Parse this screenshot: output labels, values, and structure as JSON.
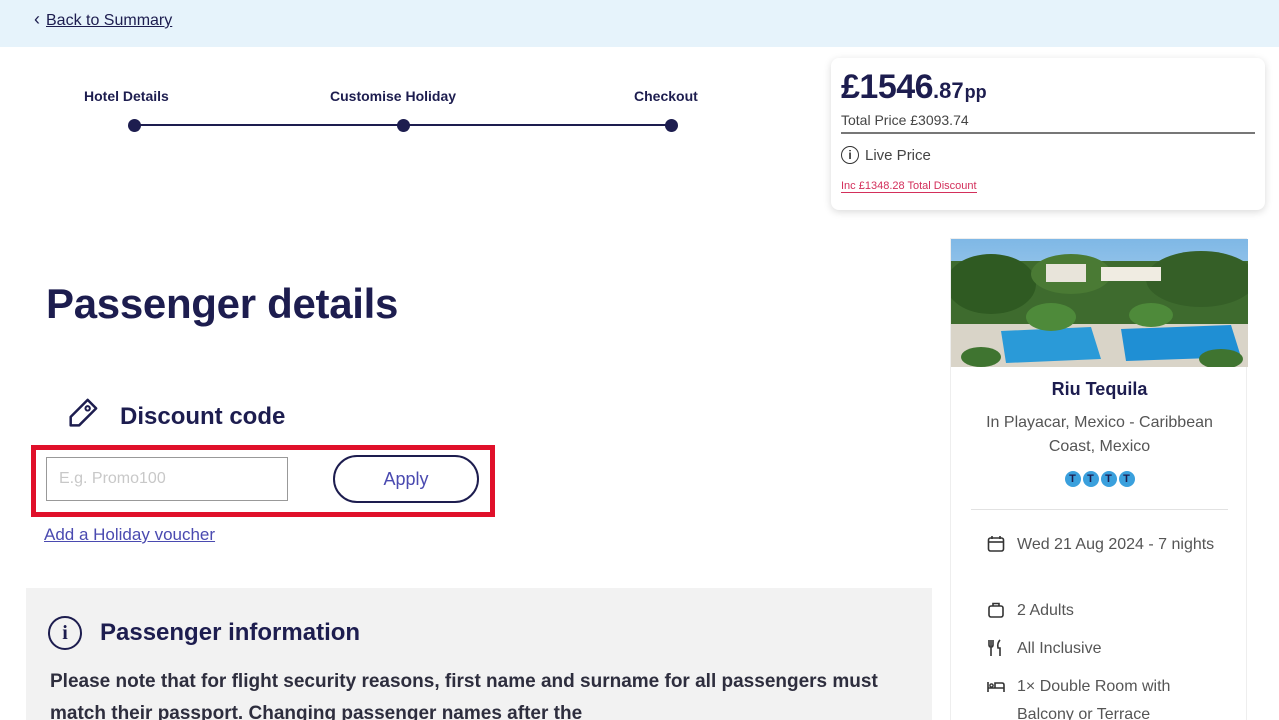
{
  "nav": {
    "back_label": "Back to Summary"
  },
  "steps": [
    {
      "label": "Hotel Details"
    },
    {
      "label": "Customise Holiday"
    },
    {
      "label": "Checkout"
    }
  ],
  "price": {
    "whole": "£1546",
    "decimal": ".87",
    "per": "pp",
    "total": "Total Price £3093.74",
    "live": "Live Price",
    "discount": "Inc £1348.28 Total Discount"
  },
  "page_title": "Passenger details",
  "discount": {
    "heading": "Discount code",
    "placeholder": "E.g. Promo100",
    "apply_label": "Apply",
    "voucher_link": "Add a Holiday voucher"
  },
  "passenger_info": {
    "heading": "Passenger information",
    "text": "Please note that for flight security reasons, first name and surname for all passengers must match their passport. Changing passenger names after the"
  },
  "hotel": {
    "name": "Riu Tequila",
    "location": "In Playacar, Mexico - Caribbean Coast, Mexico",
    "rating_glyph": "T",
    "rating_count": 4,
    "details": {
      "date": "Wed 21 Aug 2024 - 7 nights",
      "guests": "2 Adults",
      "board": "All Inclusive",
      "room": "1× Double Room with Balcony or Terrace"
    }
  },
  "colors": {
    "navy": "#1d1d4f",
    "topbar": "#e6f3fb",
    "highlight_red": "#e0102a",
    "discount_pink": "#d32f5b",
    "link_blue": "#4a4ab0"
  }
}
